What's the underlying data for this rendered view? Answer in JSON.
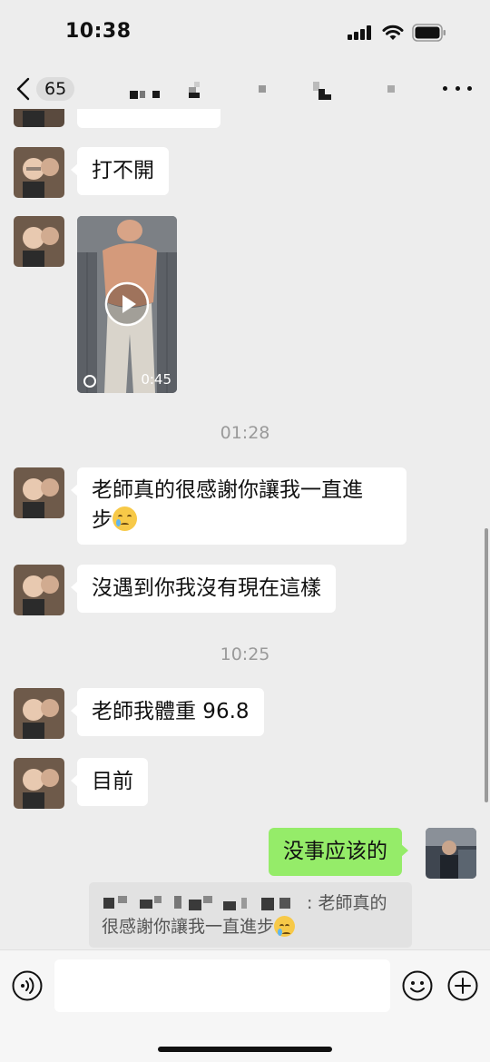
{
  "status_bar": {
    "time": "10:38"
  },
  "header": {
    "unread_count": "65"
  },
  "messages": [
    {
      "type": "text",
      "dir": "in",
      "text": "打不開"
    },
    {
      "type": "video",
      "dir": "in",
      "duration": "0:45"
    },
    {
      "type": "time",
      "text": "01:28"
    },
    {
      "type": "text",
      "dir": "in",
      "line1": "老師真的很感謝你讓我一直進",
      "line2": "步",
      "emoji": "crying-face"
    },
    {
      "type": "text",
      "dir": "in",
      "text": "沒遇到你我沒有現在這樣"
    },
    {
      "type": "time",
      "text": "10:25"
    },
    {
      "type": "text",
      "dir": "in",
      "text": "老師我體重 96.8"
    },
    {
      "type": "text",
      "dir": "in",
      "text": "目前"
    },
    {
      "type": "text",
      "dir": "out",
      "text": "没事应该的"
    }
  ],
  "quote": {
    "line1_suffix": ": 老師真的",
    "line2": "很感謝你讓我一直進步",
    "emoji": "crying-face"
  },
  "input": {
    "placeholder": ""
  },
  "colors": {
    "background": "#ededed",
    "outgoing_bubble": "#95ec69",
    "incoming_bubble": "#ffffff"
  }
}
